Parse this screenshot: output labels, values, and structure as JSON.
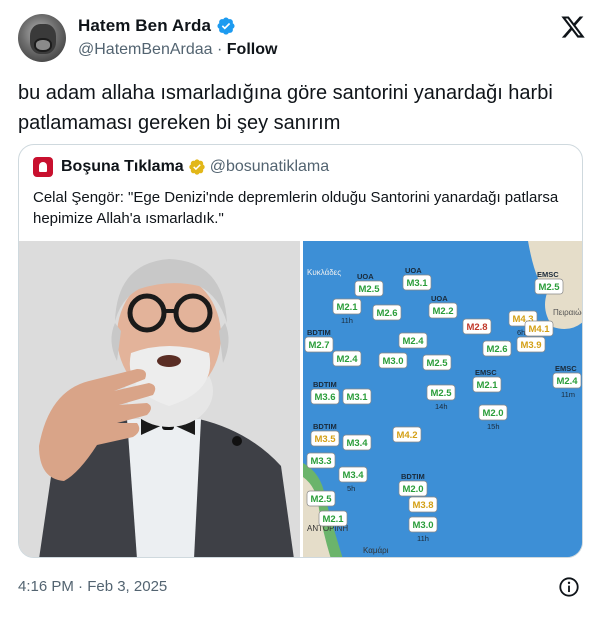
{
  "author": {
    "display_name": "Hatem Ben Arda",
    "handle": "@HatemBenArdaa",
    "separator": "·",
    "follow_label": "Follow"
  },
  "tweet": {
    "text": "bu adam allaha ısmarladığına göre santorini yanardağı harbi patlamaması gereken bi şey sanırım",
    "timestamp": "4:16 PM · Feb 3, 2025"
  },
  "quote": {
    "display_name": "Boşuna Tıklama",
    "handle": "@bosunatiklama",
    "text": "Celal Şengör: \"Ege Denizi'nde depremlerin olduğu Santorini yanardağı patlarsa hepimize Allah'a ısmarladık.\""
  },
  "map": {
    "place_labels": [
      "Κυκλάδες",
      "Πειραιώς",
      "Καμάρι",
      "ΑΝΤΟΡΙΝΗ"
    ],
    "markers": [
      {
        "mag": "M2.5",
        "src": "UOA",
        "age": "",
        "color": "#2a9d3a"
      },
      {
        "mag": "M3.1",
        "src": "UOA",
        "age": "",
        "color": "#2a9d3a"
      },
      {
        "mag": "M2.5",
        "src": "EMSC",
        "age": "",
        "color": "#2a9d3a"
      },
      {
        "mag": "M2.1",
        "src": "",
        "age": "11h",
        "color": "#2a9d3a"
      },
      {
        "mag": "M2.6",
        "src": "",
        "age": "",
        "color": "#2a9d3a"
      },
      {
        "mag": "M2.8",
        "src": "",
        "age": "",
        "color": "#c0392b"
      },
      {
        "mag": "M4.3",
        "src": "",
        "age": "6h",
        "color": "#d4a017"
      },
      {
        "mag": "M4.1",
        "src": "",
        "age": "",
        "color": "#d4a017"
      },
      {
        "mag": "M2.7",
        "src": "BDTIM",
        "age": "",
        "color": "#2a9d3a"
      },
      {
        "mag": "M2.4",
        "src": "",
        "age": "",
        "color": "#2a9d3a"
      },
      {
        "mag": "M3.0",
        "src": "",
        "age": "",
        "color": "#2a9d3a"
      },
      {
        "mag": "M2.5",
        "src": "",
        "age": "",
        "color": "#2a9d3a"
      },
      {
        "mag": "M2.6",
        "src": "",
        "age": "",
        "color": "#2a9d3a"
      },
      {
        "mag": "M3.9",
        "src": "",
        "age": "",
        "color": "#d4a017"
      },
      {
        "mag": "M2.4",
        "src": "EMSC",
        "age": "11m",
        "color": "#2a9d3a"
      },
      {
        "mag": "M3.6",
        "src": "BDTIM",
        "age": "",
        "color": "#2a9d3a"
      },
      {
        "mag": "M3.1",
        "src": "",
        "age": "",
        "color": "#2a9d3a"
      },
      {
        "mag": "M2.5",
        "src": "",
        "age": "14h",
        "color": "#2a9d3a"
      },
      {
        "mag": "M2.1",
        "src": "EMSC",
        "age": "",
        "color": "#2a9d3a"
      },
      {
        "mag": "M2.0",
        "src": "",
        "age": "15h",
        "color": "#2a9d3a"
      },
      {
        "mag": "M3.4",
        "src": "",
        "age": "",
        "color": "#2a9d3a"
      },
      {
        "mag": "M3.5",
        "src": "BDTIM",
        "age": "",
        "color": "#d4a017"
      },
      {
        "mag": "M3.4",
        "src": "",
        "age": "5h",
        "color": "#2a9d3a"
      },
      {
        "mag": "M4.2",
        "src": "",
        "age": "",
        "color": "#d4a017"
      },
      {
        "mag": "M3.3",
        "src": "",
        "age": "",
        "color": "#2a9d3a"
      },
      {
        "mag": "M2.5",
        "src": "",
        "age": "",
        "color": "#2a9d3a"
      },
      {
        "mag": "M2.1",
        "src": "",
        "age": "",
        "color": "#2a9d3a"
      },
      {
        "mag": "M2.0",
        "src": "BDTIM",
        "age": "",
        "color": "#2a9d3a"
      },
      {
        "mag": "M3.8",
        "src": "",
        "age": "",
        "color": "#d4a017"
      },
      {
        "mag": "M3.0",
        "src": "",
        "age": "11h",
        "color": "#2a9d3a"
      },
      {
        "mag": "M2.2",
        "src": "UOA",
        "age": "",
        "color": "#2a9d3a"
      },
      {
        "mag": "M2.4",
        "src": "",
        "age": "",
        "color": "#2a9d3a"
      }
    ]
  },
  "colors": {
    "verified_blue": "#1d9bf0",
    "verified_gold": "#e2b719",
    "sea": "#3d8fd6",
    "land": "#e5ddc9"
  },
  "icons": {
    "verified": "verified-badge-icon",
    "gold_verified": "gold-check-icon",
    "logo": "x-logo-icon",
    "info": "info-icon"
  }
}
